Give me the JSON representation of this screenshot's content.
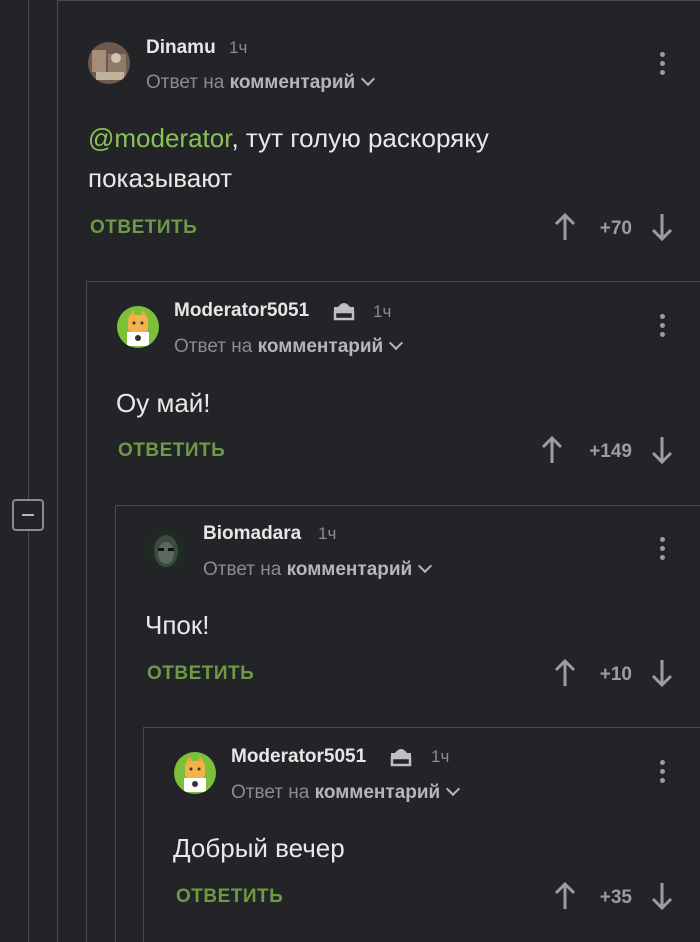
{
  "comments": [
    {
      "author": "Dinamu",
      "time": "1ч",
      "reply_prefix": "Ответ на",
      "reply_target": "комментарий",
      "mention": "@moderator",
      "text": ", тут голую раскоряку показывают",
      "reply_label": "ОТВЕТИТЬ",
      "score": "+70",
      "moderator": false
    },
    {
      "author": "Moderator5051",
      "time": "1ч",
      "reply_prefix": "Ответ на",
      "reply_target": "комментарий",
      "text": "Оу май!",
      "reply_label": "ОТВЕТИТЬ",
      "score": "+149",
      "moderator": true
    },
    {
      "author": "Biomadara",
      "time": "1ч",
      "reply_prefix": "Ответ на",
      "reply_target": "комментарий",
      "text": "Чпок!",
      "reply_label": "ОТВЕТИТЬ",
      "score": "+10",
      "moderator": false
    },
    {
      "author": "Moderator5051",
      "time": "1ч",
      "reply_prefix": "Ответ на",
      "reply_target": "комментарий",
      "text": "Добрый вечер",
      "reply_label": "ОТВЕТИТЬ",
      "score": "+35",
      "moderator": true
    }
  ],
  "icons": {
    "upvote": "arrow-up-icon",
    "downvote": "arrow-down-icon",
    "menu": "more-vertical-icon",
    "moderator": "moderator-badge-icon",
    "collapse": "collapse-minus-icon"
  },
  "colors": {
    "background": "#232427",
    "accent_green": "#6d9a45",
    "mention": "#8ac157",
    "muted": "#8b8c8f"
  }
}
